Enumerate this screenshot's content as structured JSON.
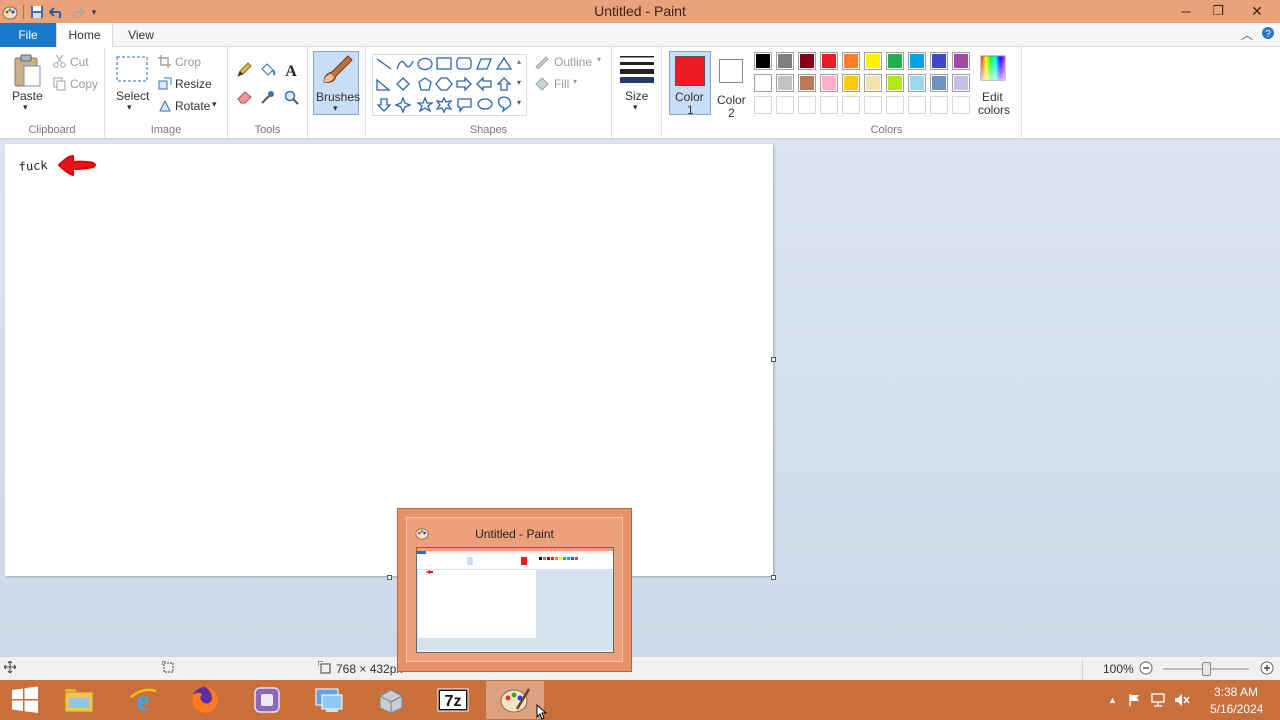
{
  "window": {
    "title": "Untitled - Paint"
  },
  "tabs": [
    {
      "label": "File"
    },
    {
      "label": "Home"
    },
    {
      "label": "View"
    }
  ],
  "ribbon": {
    "clipboard": {
      "group_label": "Clipboard",
      "paste": "Paste",
      "cut": "Cut",
      "copy": "Copy"
    },
    "image": {
      "group_label": "Image",
      "select": "Select",
      "crop": "Crop",
      "resize": "Resize",
      "rotate": "Rotate"
    },
    "tools": {
      "group_label": "Tools"
    },
    "brushes": {
      "label": "Brushes"
    },
    "shapes": {
      "group_label": "Shapes",
      "outline": "Outline",
      "fill": "Fill"
    },
    "size": {
      "label": "Size"
    },
    "color1": {
      "label_line1": "Color",
      "label_line2": "1",
      "value": "#ed1c24"
    },
    "color2": {
      "label_line1": "Color",
      "label_line2": "2",
      "value": "#ffffff"
    },
    "colors": {
      "group_label": "Colors",
      "edit_line1": "Edit",
      "edit_line2": "colors",
      "row1": [
        "#000000",
        "#7f7f7f",
        "#880015",
        "#ed1c24",
        "#ff7f27",
        "#fff200",
        "#22b14c",
        "#00a2e8",
        "#3f48cc",
        "#a349a4"
      ],
      "row2": [
        "#ffffff",
        "#c3c3c3",
        "#b97a57",
        "#ffaec9",
        "#ffc90e",
        "#efe4b0",
        "#b5e61d",
        "#99d9ea",
        "#7092be",
        "#c8bfe7"
      ]
    }
  },
  "canvas": {
    "handwritten_text": "fuck"
  },
  "statusbar": {
    "dimensions": "768 × 432px",
    "zoom": "100%"
  },
  "thumbnail": {
    "title": "Untitled - Paint"
  },
  "tray": {
    "time": "3:38 AM",
    "date": "5/16/2024"
  }
}
